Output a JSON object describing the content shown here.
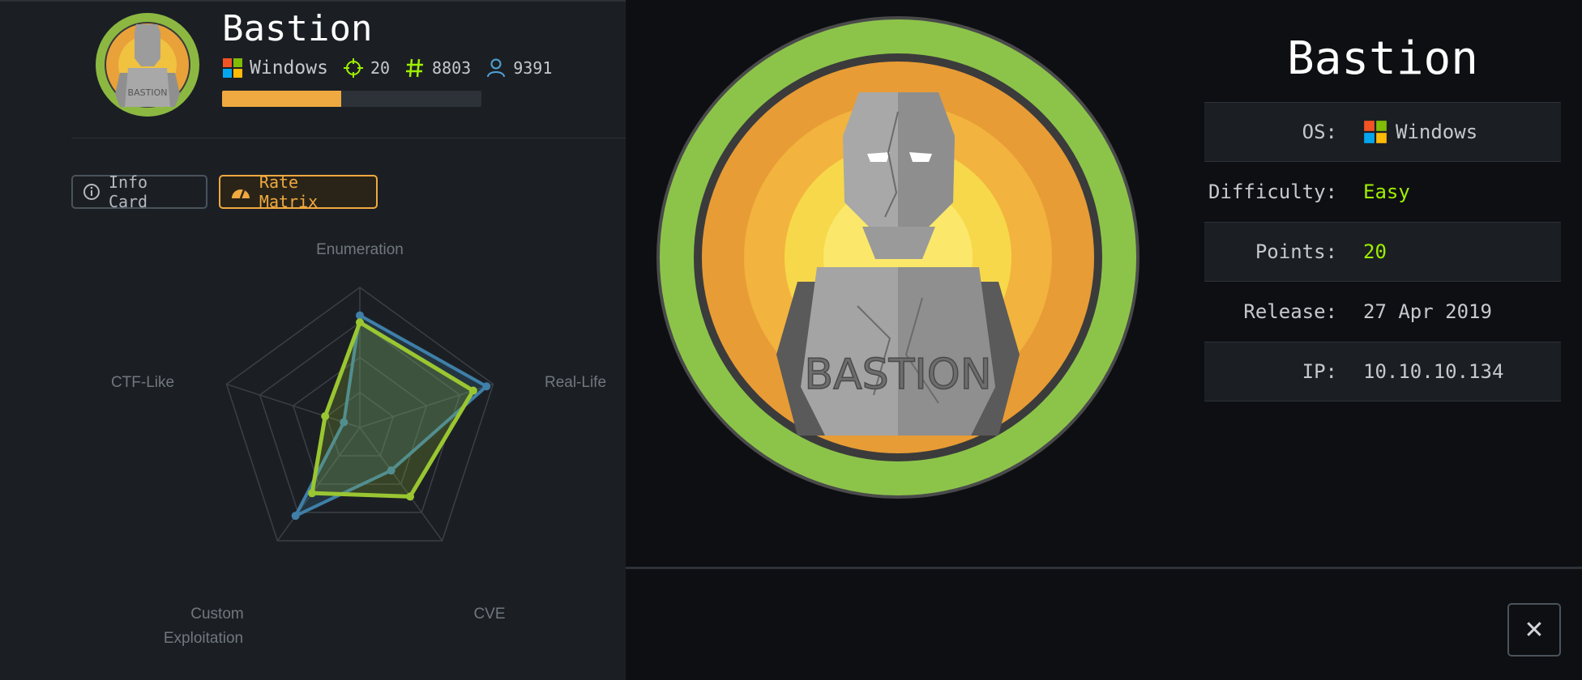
{
  "machine": {
    "name": "Bastion",
    "os": "Windows",
    "points": "20",
    "owns_user": "8803",
    "owns_system": "9391",
    "rating_fill": 0.46
  },
  "tabs": {
    "info_card": "Info Card",
    "rate_matrix": "Rate Matrix"
  },
  "radar": {
    "axes": [
      "Enumeration",
      "Real-Life",
      "CVE",
      "Custom Exploitation",
      "CTF-Like"
    ],
    "axis_lines": {
      "custom_1": "Custom",
      "custom_2": "Exploitation"
    },
    "max": 10,
    "series": [
      {
        "color": "#3f7fa8",
        "values": [
          8.0,
          9.5,
          3.8,
          7.8,
          1.2
        ]
      },
      {
        "color": "#9ac631",
        "values": [
          7.5,
          8.5,
          6.1,
          5.8,
          2.6
        ]
      }
    ]
  },
  "details": {
    "title": "Bastion",
    "rows": [
      {
        "label": "OS:",
        "value": "Windows",
        "icon": "windows-icon"
      },
      {
        "label": "Difficulty:",
        "value": "Easy"
      },
      {
        "label": "Points:",
        "value": "20"
      },
      {
        "label": "Release:",
        "value": "27 Apr 2019"
      },
      {
        "label": "IP:",
        "value": "10.10.10.134"
      }
    ]
  },
  "close_label": "✕",
  "colors": {
    "accent": "#f0a940",
    "green": "#9fef00",
    "avatar_ring": "#8cb842"
  }
}
